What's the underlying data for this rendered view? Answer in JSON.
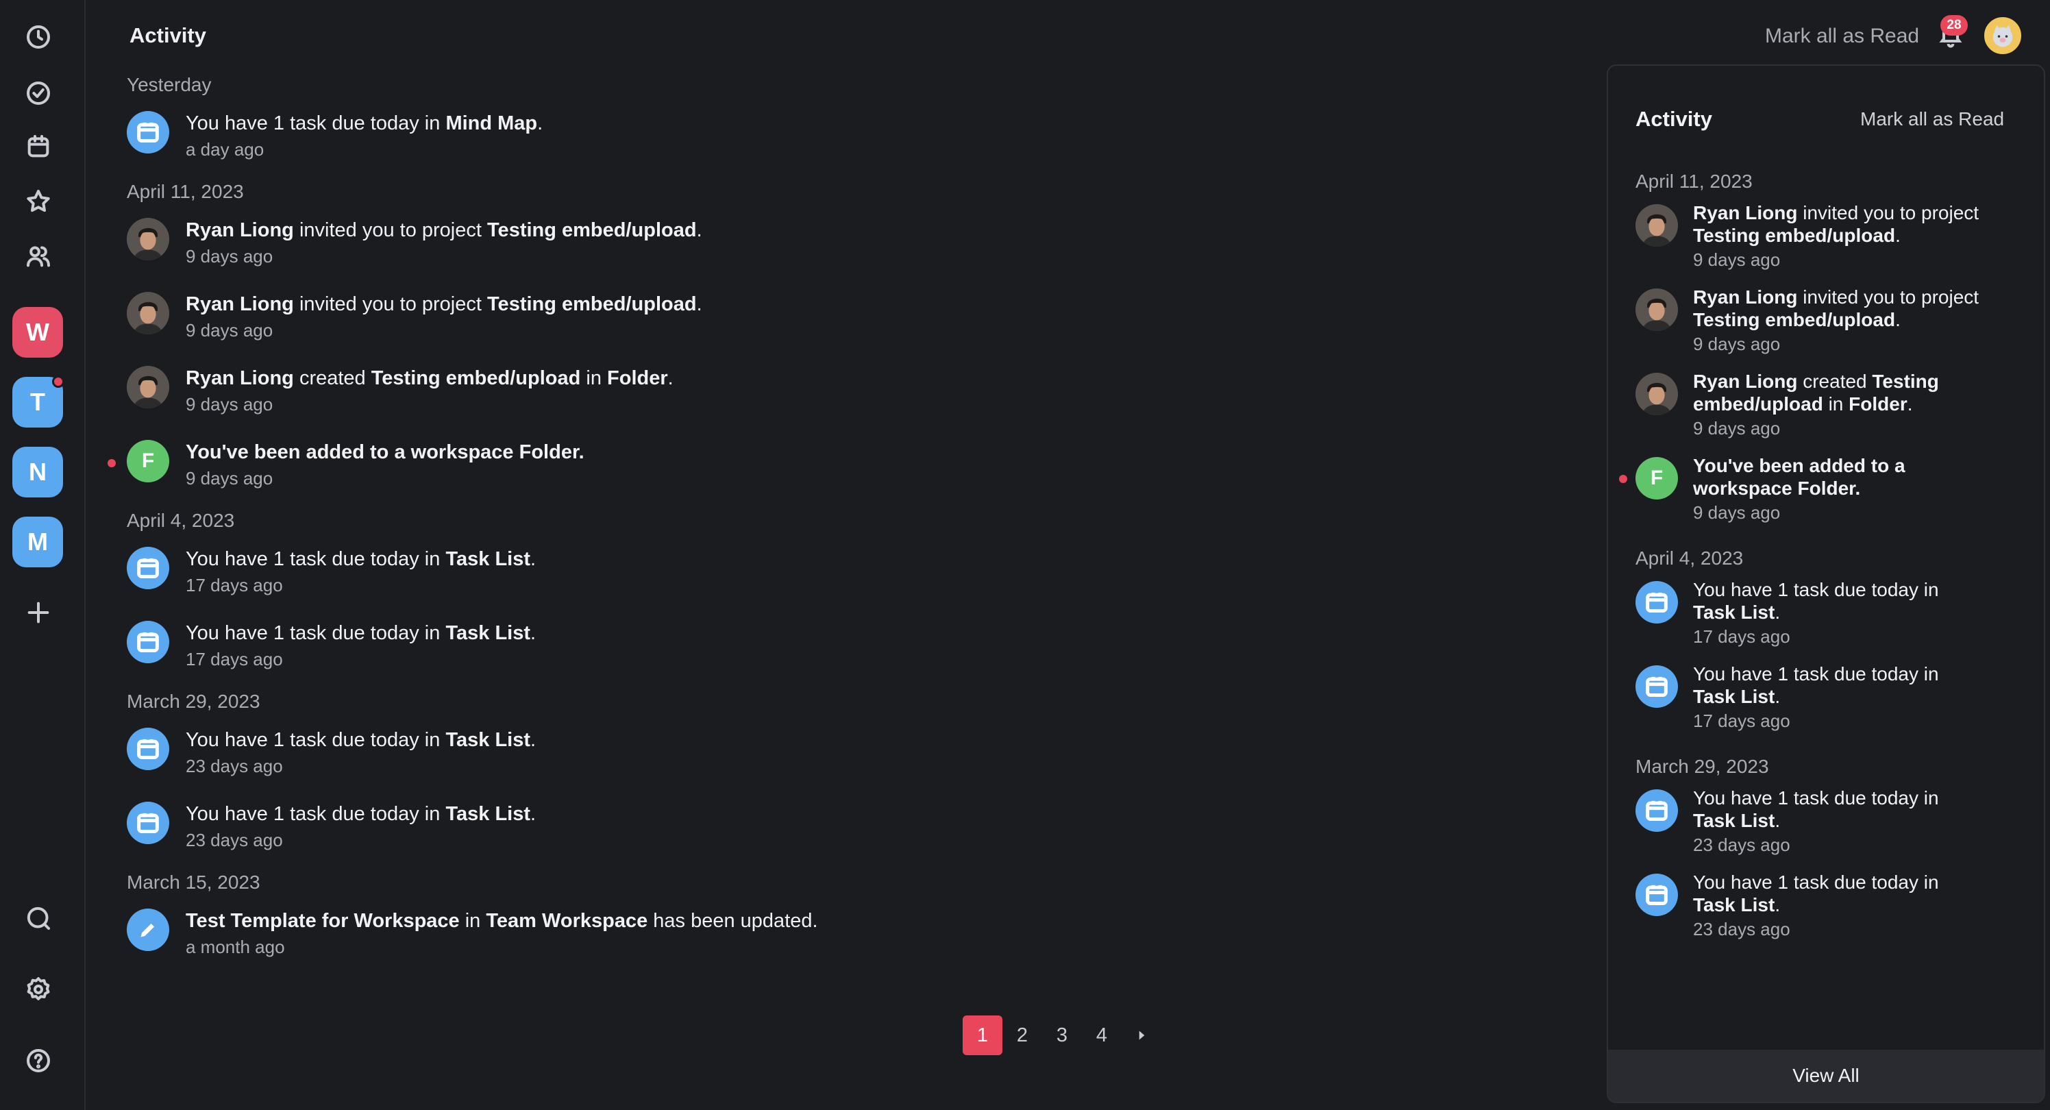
{
  "sidebar": {
    "workspaces": [
      {
        "letter": "W",
        "color": "#e44d65"
      },
      {
        "letter": "T",
        "color": "#5aa8f0",
        "dot": true
      },
      {
        "letter": "N",
        "color": "#5aa8f0"
      },
      {
        "letter": "M",
        "color": "#5aa8f0"
      }
    ]
  },
  "header": {
    "title": "Activity",
    "mark_all": "Mark all as Read",
    "badge_count": "28"
  },
  "feed": {
    "groups": [
      {
        "date": "Yesterday",
        "items": [
          {
            "icon": "calendar-icon",
            "pre": "You have 1 task due today in ",
            "b1": "Mind Map",
            "mid": "",
            "b2": "",
            "mid2": "",
            "b3": "",
            "post": ".",
            "ago": "a day ago"
          }
        ]
      },
      {
        "date": "April 11, 2023",
        "items": [
          {
            "icon": "avatar",
            "pre": "",
            "b1": "Ryan Liong",
            "mid": " invited you to project ",
            "b2": "Testing embed/upload",
            "mid2": "",
            "b3": "",
            "post": ".",
            "ago": "9 days ago"
          },
          {
            "icon": "avatar",
            "pre": "",
            "b1": "Ryan Liong",
            "mid": " invited you to project ",
            "b2": "Testing embed/upload",
            "mid2": "",
            "b3": "",
            "post": ".",
            "ago": "9 days ago"
          },
          {
            "icon": "avatar",
            "pre": "",
            "b1": "Ryan Liong",
            "mid": " created ",
            "b2": "Testing embed/upload",
            "mid2": " in ",
            "b3": "Folder",
            "post": ".",
            "ago": "9 days ago"
          },
          {
            "icon": "F",
            "unread": true,
            "pre": "",
            "b1": "You've been added to a workspace Folder.",
            "mid": "",
            "b2": "",
            "mid2": "",
            "b3": "",
            "post": "",
            "ago": "9 days ago"
          }
        ]
      },
      {
        "date": "April 4, 2023",
        "items": [
          {
            "icon": "calendar-icon",
            "pre": "You have 1 task due today in ",
            "b1": "Task List",
            "mid": "",
            "b2": "",
            "mid2": "",
            "b3": "",
            "post": ".",
            "ago": "17 days ago"
          },
          {
            "icon": "calendar-icon",
            "pre": "You have 1 task due today in ",
            "b1": "Task List",
            "mid": "",
            "b2": "",
            "mid2": "",
            "b3": "",
            "post": ".",
            "ago": "17 days ago"
          }
        ]
      },
      {
        "date": "March 29, 2023",
        "items": [
          {
            "icon": "calendar-icon",
            "pre": "You have 1 task due today in ",
            "b1": "Task List",
            "mid": "",
            "b2": "",
            "mid2": "",
            "b3": "",
            "post": ".",
            "ago": "23 days ago"
          },
          {
            "icon": "calendar-icon",
            "pre": "You have 1 task due today in ",
            "b1": "Task List",
            "mid": "",
            "b2": "",
            "mid2": "",
            "b3": "",
            "post": ".",
            "ago": "23 days ago"
          }
        ]
      },
      {
        "date": "March 15, 2023",
        "items": [
          {
            "icon": "pencil-icon",
            "pre": "",
            "b1": "Test Template for Workspace",
            "mid": " in ",
            "b2": "Team Workspace",
            "mid2": " has been updated.",
            "b3": "",
            "post": "",
            "ago": "a month ago"
          }
        ]
      }
    ]
  },
  "pagination": {
    "pages": [
      "1",
      "2",
      "3",
      "4"
    ],
    "current": "1"
  },
  "panel": {
    "title": "Activity",
    "mark_all": "Mark all as Read",
    "view_all": "View All",
    "groups": [
      {
        "date": "April 11, 2023",
        "items": [
          {
            "icon": "avatar",
            "pre": "",
            "b1": "Ryan Liong",
            "mid": " invited you to project ",
            "b2": "Testing embed/upload",
            "mid2": "",
            "b3": "",
            "post": ".",
            "ago": "9 days ago"
          },
          {
            "icon": "avatar",
            "pre": "",
            "b1": "Ryan Liong",
            "mid": " invited you to project ",
            "b2": "Testing embed/upload",
            "mid2": "",
            "b3": "",
            "post": ".",
            "ago": "9 days ago"
          },
          {
            "icon": "avatar",
            "pre": "",
            "b1": "Ryan Liong",
            "mid": " created ",
            "b2": "Testing embed/upload",
            "mid2": " in ",
            "b3": "Folder",
            "post": ".",
            "ago": "9 days ago"
          },
          {
            "icon": "F",
            "unread": true,
            "pre": "",
            "b1": "You've been added to a workspace Folder.",
            "mid": "",
            "b2": "",
            "mid2": "",
            "b3": "",
            "post": "",
            "ago": "9 days ago"
          }
        ]
      },
      {
        "date": "April 4, 2023",
        "items": [
          {
            "icon": "calendar-icon",
            "pre": "You have 1 task due today in ",
            "b1": "Task List",
            "mid": "",
            "b2": "",
            "mid2": "",
            "b3": "",
            "post": ".",
            "ago": "17 days ago"
          },
          {
            "icon": "calendar-icon",
            "pre": "You have 1 task due today in ",
            "b1": "Task List",
            "mid": "",
            "b2": "",
            "mid2": "",
            "b3": "",
            "post": ".",
            "ago": "17 days ago"
          }
        ]
      },
      {
        "date": "March 29, 2023",
        "items": [
          {
            "icon": "calendar-icon",
            "pre": "You have 1 task due today in ",
            "b1": "Task List",
            "mid": "",
            "b2": "",
            "mid2": "",
            "b3": "",
            "post": ".",
            "ago": "23 days ago"
          },
          {
            "icon": "calendar-icon",
            "pre": "You have 1 task due today in ",
            "b1": "Task List",
            "mid": "",
            "b2": "",
            "mid2": "",
            "b3": "",
            "post": ".",
            "ago": "23 days ago"
          }
        ]
      }
    ]
  },
  "colors": {
    "accent": "#e9455b",
    "blue": "#5aa8f0",
    "green": "#5fc46a",
    "bg": "#1b1c20"
  }
}
